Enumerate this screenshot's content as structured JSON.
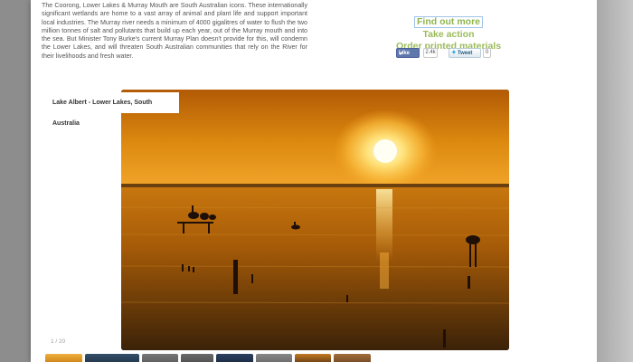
{
  "intro_text": "The Coorong, Lower Lakes & Murray Mouth are South Australian icons. These internationally significant wetlands are home to a vast array of animal and plant life and support important local industries. The Murray river needs a minimum of 4000 gigalitres of water to flush the two million tonnes of salt and pollutants that build up each year, out of the Murray mouth and into the sea. But Minister Tony Burke's current Murray Plan doesn't provide for this, will condemn the Lower Lakes, and will threaten South Australian communities that rely on the River for their livelihoods and fresh water.",
  "links": {
    "find_out_more": "Find out more",
    "take_action": "Take action",
    "order_materials": "Order printed materials"
  },
  "social": {
    "like_label": "Like",
    "like_count": "2.4k",
    "tweet_label": "Tweet",
    "tweet_count": "0"
  },
  "slideshow": {
    "caption": "Lake Albert - Lower Lakes, South Australia",
    "counter": "1 / 20"
  },
  "colors": {
    "link_green": "#9bbb59",
    "facebook_blue": "#5f78ab",
    "twitter_blue": "#2aa9e0"
  },
  "icons": {
    "like": "facebook-thumb-icon",
    "tweet": "twitter-bird-icon"
  }
}
